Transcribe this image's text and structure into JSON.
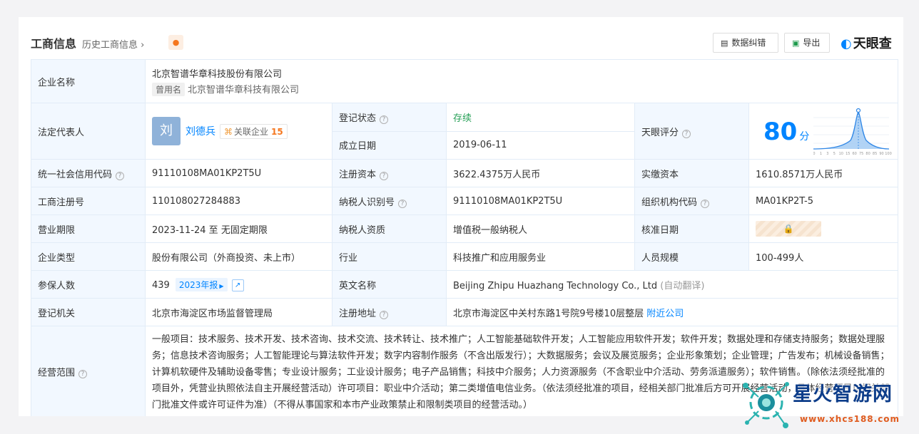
{
  "header": {
    "title": "工商信息",
    "history_link": "历史工商信息",
    "data_correction_btn": "数据纠错",
    "export_btn": "导出",
    "brand": "天眼查"
  },
  "company": {
    "name_label": "企业名称",
    "name": "北京智谱华章科技股份有限公司",
    "former_tag": "曾用名",
    "former_name": "北京智谱华章科技有限公司"
  },
  "rep": {
    "label": "法定代表人",
    "avatar_char": "刘",
    "name": "刘德兵",
    "related_label": "关联企业",
    "related_count": "15"
  },
  "status": {
    "label": "登记状态",
    "value": "存续"
  },
  "founded": {
    "label": "成立日期",
    "value": "2019-06-11"
  },
  "rating": {
    "label": "天眼评分",
    "score": "80",
    "unit": "分",
    "axis_ticks": [
      "0",
      "1",
      "3",
      "5",
      "10",
      "15",
      "60",
      "75",
      "80",
      "85",
      "90",
      "100"
    ]
  },
  "credit_code": {
    "label": "统一社会信用代码",
    "value": "91110108MA01KP2T5U"
  },
  "reg_capital": {
    "label": "注册资本",
    "value": "3622.4375万人民币"
  },
  "paid_capital": {
    "label": "实缴资本",
    "value": "1610.8571万人民币"
  },
  "reg_no": {
    "label": "工商注册号",
    "value": "110108027284883"
  },
  "tax_id": {
    "label": "纳税人识别号",
    "value": "91110108MA01KP2T5U"
  },
  "org_code": {
    "label": "组织机构代码",
    "value": "MA01KP2T-5"
  },
  "term": {
    "label": "营业期限",
    "value": "2023-11-24 至 无固定期限"
  },
  "taxpayer_type": {
    "label": "纳税人资质",
    "value": "增值税一般纳税人"
  },
  "approval_date": {
    "label": "核准日期"
  },
  "company_type": {
    "label": "企业类型",
    "value": "股份有限公司（外商投资、未上市）"
  },
  "industry": {
    "label": "行业",
    "value": "科技推广和应用服务业"
  },
  "staff_size": {
    "label": "人员规模",
    "value": "100-499人"
  },
  "insured": {
    "label": "参保人数",
    "value": "439",
    "report_btn": "2023年报"
  },
  "english_name": {
    "label": "英文名称",
    "value": "Beijing Zhipu Huazhang Technology Co., Ltd",
    "auto_translate": "(自动翻译)"
  },
  "authority": {
    "label": "登记机关",
    "value": "北京市海淀区市场监督管理局"
  },
  "address": {
    "label": "注册地址",
    "value": "北京市海淀区中关村东路1号院9号楼10层整层",
    "nearby_link": "附近公司"
  },
  "scope": {
    "label": "经营范围",
    "text": "一般项目：技术服务、技术开发、技术咨询、技术交流、技术转让、技术推广；人工智能基础软件开发；人工智能应用软件开发；软件开发；数据处理和存储支持服务；数据处理服务；信息技术咨询服务；人工智能理论与算法软件开发；数字内容制作服务（不含出版发行）；大数据服务；会议及展览服务；企业形象策划；企业管理；广告发布；机械设备销售；计算机软硬件及辅助设备零售；专业设计服务；工业设计服务；电子产品销售；科技中介服务；人力资源服务（不含职业中介活动、劳务派遣服务）；软件销售。（除依法须经批准的项目外，凭营业执照依法自主开展经营活动）许可项目：职业中介活动；第二类增值电信业务。（依法须经批准的项目，经相关部门批准后方可开展经营活动，具体经营项目以相关部门批准文件或许可证件为准）（不得从事国家和本市产业政策禁止和限制类项目的经营活动。）"
  },
  "watermark": {
    "text": "星火智游网",
    "url": "www.xhcs188.com"
  }
}
